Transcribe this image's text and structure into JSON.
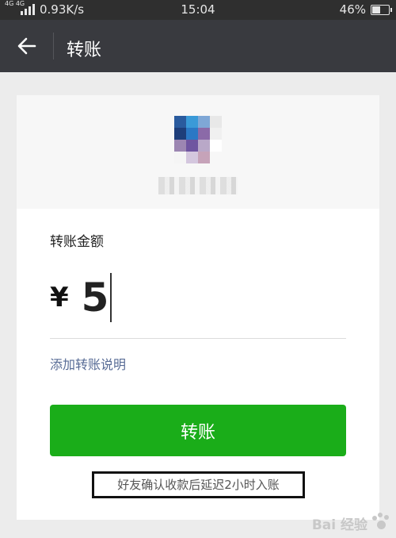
{
  "status_bar": {
    "network": "4G 4G",
    "speed": "0.93K/s",
    "time": "15:04",
    "battery": "46%",
    "battery_level": 0.46
  },
  "navbar": {
    "title": "转账",
    "back_icon": "arrow-left-icon"
  },
  "payee": {
    "avatar_colors": [
      "#2a5b9e",
      "#3a9ad8",
      "#7fa7d6",
      "#e8e8e8",
      "#1e3e7a",
      "#2b78c5",
      "#8b6aa8",
      "#f0f0f0",
      "#9c86b2",
      "#6f55a0",
      "#b9a8c8",
      "#ffffff",
      "#f5f5f5",
      "#d4c7de",
      "#c6a3b9",
      "#f7f7f7"
    ]
  },
  "form": {
    "amount_label": "转账金额",
    "currency_symbol": "¥",
    "amount_value": "5",
    "add_note_label": "添加转账说明",
    "submit_label": "转账",
    "delay_notice": "好友确认收款后延迟2小时入账"
  },
  "colors": {
    "primary_green": "#1aad19",
    "link_blue": "#576b95",
    "nav_bg": "#393a3f"
  },
  "watermark": {
    "text": "Bai 经验"
  }
}
